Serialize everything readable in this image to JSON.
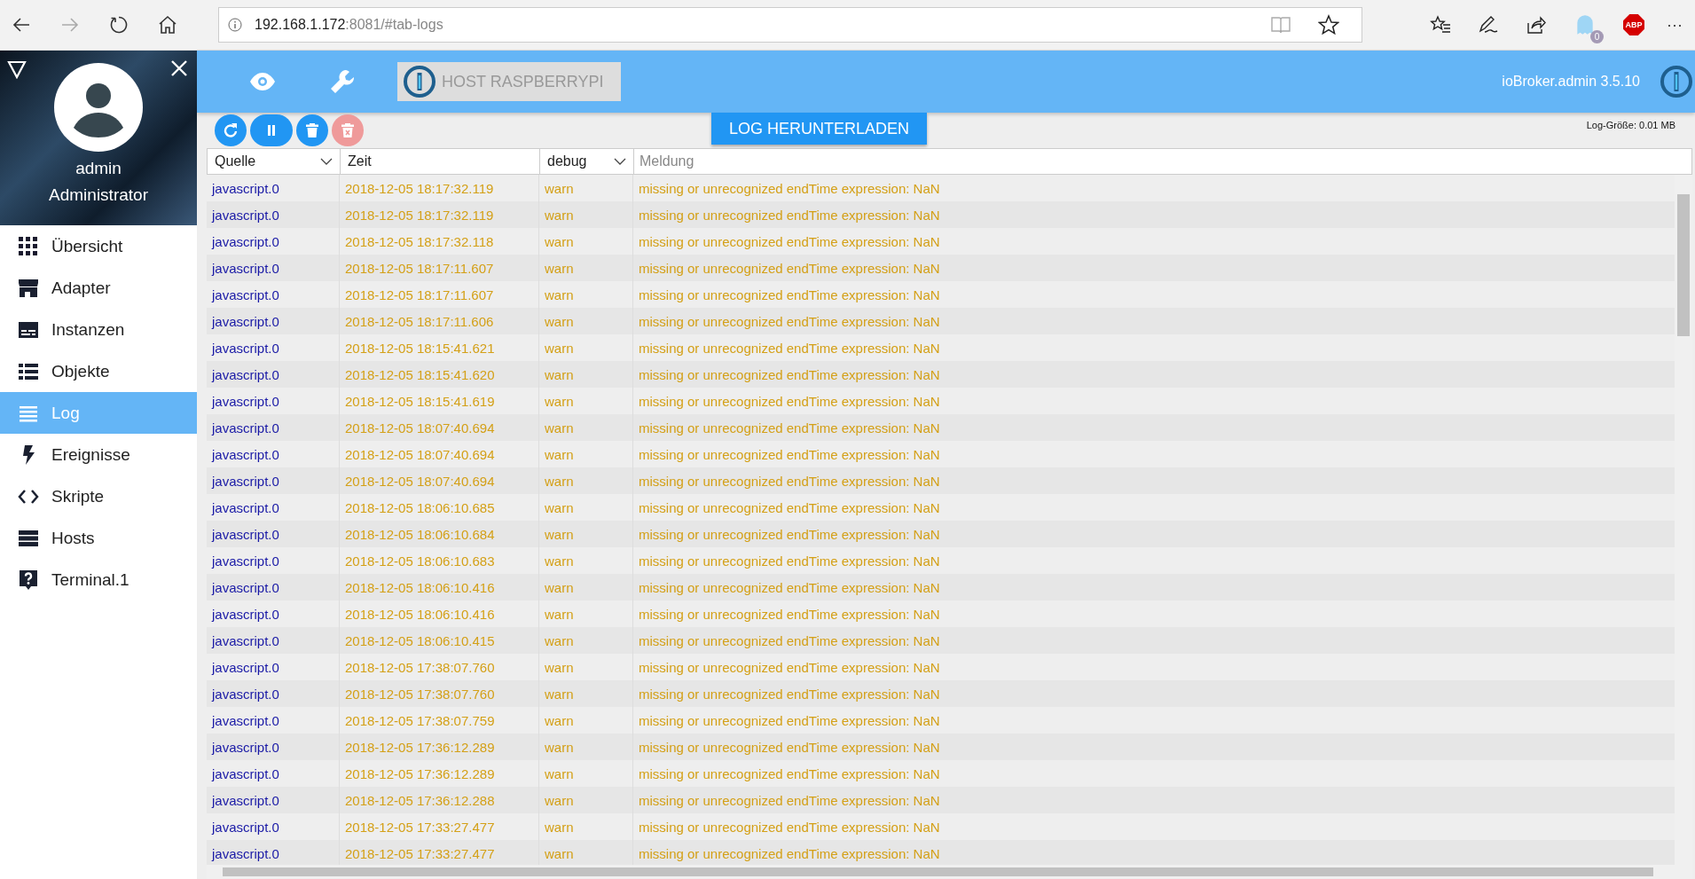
{
  "browser": {
    "url_host": "192.168.1.172",
    "url_rest": ":8081/#tab-logs",
    "extension_badge": "0",
    "adblock_label": "ABP",
    "more": "···"
  },
  "sidebar": {
    "user_name": "admin",
    "user_role": "Administrator",
    "items": [
      {
        "label": "Übersicht",
        "selected": false
      },
      {
        "label": "Adapter",
        "selected": false
      },
      {
        "label": "Instanzen",
        "selected": false
      },
      {
        "label": "Objekte",
        "selected": false
      },
      {
        "label": "Log",
        "selected": true
      },
      {
        "label": "Ereignisse",
        "selected": false
      },
      {
        "label": "Skripte",
        "selected": false
      },
      {
        "label": "Hosts",
        "selected": false
      },
      {
        "label": "Terminal.1",
        "selected": false
      }
    ]
  },
  "header": {
    "host_button": "HOST RASPBERRYPI",
    "version": "ioBroker.admin 3.5.10"
  },
  "toolbar": {
    "buttons": [
      {
        "disabled": false
      },
      {
        "disabled": false
      },
      {
        "disabled": false
      },
      {
        "disabled": true
      }
    ],
    "download_button": "LOG HERUNTERLADEN",
    "log_size": "Log-Größe: 0.01 MB"
  },
  "table": {
    "columns": [
      {
        "label": "Quelle",
        "kind": "dropdown"
      },
      {
        "label": "Zeit",
        "kind": "label"
      },
      {
        "label": "debug",
        "kind": "dropdown"
      },
      {
        "placeholder": "Meldung",
        "kind": "input"
      }
    ],
    "rows": [
      {
        "source": "javascript.0",
        "time": "2018-12-05 18:17:32.119",
        "severity": "warn",
        "message": "missing or unrecognized endTime expression: NaN"
      },
      {
        "source": "javascript.0",
        "time": "2018-12-05 18:17:32.119",
        "severity": "warn",
        "message": "missing or unrecognized endTime expression: NaN"
      },
      {
        "source": "javascript.0",
        "time": "2018-12-05 18:17:32.118",
        "severity": "warn",
        "message": "missing or unrecognized endTime expression: NaN"
      },
      {
        "source": "javascript.0",
        "time": "2018-12-05 18:17:11.607",
        "severity": "warn",
        "message": "missing or unrecognized endTime expression: NaN"
      },
      {
        "source": "javascript.0",
        "time": "2018-12-05 18:17:11.607",
        "severity": "warn",
        "message": "missing or unrecognized endTime expression: NaN"
      },
      {
        "source": "javascript.0",
        "time": "2018-12-05 18:17:11.606",
        "severity": "warn",
        "message": "missing or unrecognized endTime expression: NaN"
      },
      {
        "source": "javascript.0",
        "time": "2018-12-05 18:15:41.621",
        "severity": "warn",
        "message": "missing or unrecognized endTime expression: NaN"
      },
      {
        "source": "javascript.0",
        "time": "2018-12-05 18:15:41.620",
        "severity": "warn",
        "message": "missing or unrecognized endTime expression: NaN"
      },
      {
        "source": "javascript.0",
        "time": "2018-12-05 18:15:41.619",
        "severity": "warn",
        "message": "missing or unrecognized endTime expression: NaN"
      },
      {
        "source": "javascript.0",
        "time": "2018-12-05 18:07:40.694",
        "severity": "warn",
        "message": "missing or unrecognized endTime expression: NaN"
      },
      {
        "source": "javascript.0",
        "time": "2018-12-05 18:07:40.694",
        "severity": "warn",
        "message": "missing or unrecognized endTime expression: NaN"
      },
      {
        "source": "javascript.0",
        "time": "2018-12-05 18:07:40.694",
        "severity": "warn",
        "message": "missing or unrecognized endTime expression: NaN"
      },
      {
        "source": "javascript.0",
        "time": "2018-12-05 18:06:10.685",
        "severity": "warn",
        "message": "missing or unrecognized endTime expression: NaN"
      },
      {
        "source": "javascript.0",
        "time": "2018-12-05 18:06:10.684",
        "severity": "warn",
        "message": "missing or unrecognized endTime expression: NaN"
      },
      {
        "source": "javascript.0",
        "time": "2018-12-05 18:06:10.683",
        "severity": "warn",
        "message": "missing or unrecognized endTime expression: NaN"
      },
      {
        "source": "javascript.0",
        "time": "2018-12-05 18:06:10.416",
        "severity": "warn",
        "message": "missing or unrecognized endTime expression: NaN"
      },
      {
        "source": "javascript.0",
        "time": "2018-12-05 18:06:10.416",
        "severity": "warn",
        "message": "missing or unrecognized endTime expression: NaN"
      },
      {
        "source": "javascript.0",
        "time": "2018-12-05 18:06:10.415",
        "severity": "warn",
        "message": "missing or unrecognized endTime expression: NaN"
      },
      {
        "source": "javascript.0",
        "time": "2018-12-05 17:38:07.760",
        "severity": "warn",
        "message": "missing or unrecognized endTime expression: NaN"
      },
      {
        "source": "javascript.0",
        "time": "2018-12-05 17:38:07.760",
        "severity": "warn",
        "message": "missing or unrecognized endTime expression: NaN"
      },
      {
        "source": "javascript.0",
        "time": "2018-12-05 17:38:07.759",
        "severity": "warn",
        "message": "missing or unrecognized endTime expression: NaN"
      },
      {
        "source": "javascript.0",
        "time": "2018-12-05 17:36:12.289",
        "severity": "warn",
        "message": "missing or unrecognized endTime expression: NaN"
      },
      {
        "source": "javascript.0",
        "time": "2018-12-05 17:36:12.289",
        "severity": "warn",
        "message": "missing or unrecognized endTime expression: NaN"
      },
      {
        "source": "javascript.0",
        "time": "2018-12-05 17:36:12.288",
        "severity": "warn",
        "message": "missing or unrecognized endTime expression: NaN"
      },
      {
        "source": "javascript.0",
        "time": "2018-12-05 17:33:27.477",
        "severity": "warn",
        "message": "missing or unrecognized endTime expression: NaN"
      },
      {
        "source": "javascript.0",
        "time": "2018-12-05 17:33:27.477",
        "severity": "warn",
        "message": "missing or unrecognized endTime expression: NaN"
      }
    ]
  }
}
